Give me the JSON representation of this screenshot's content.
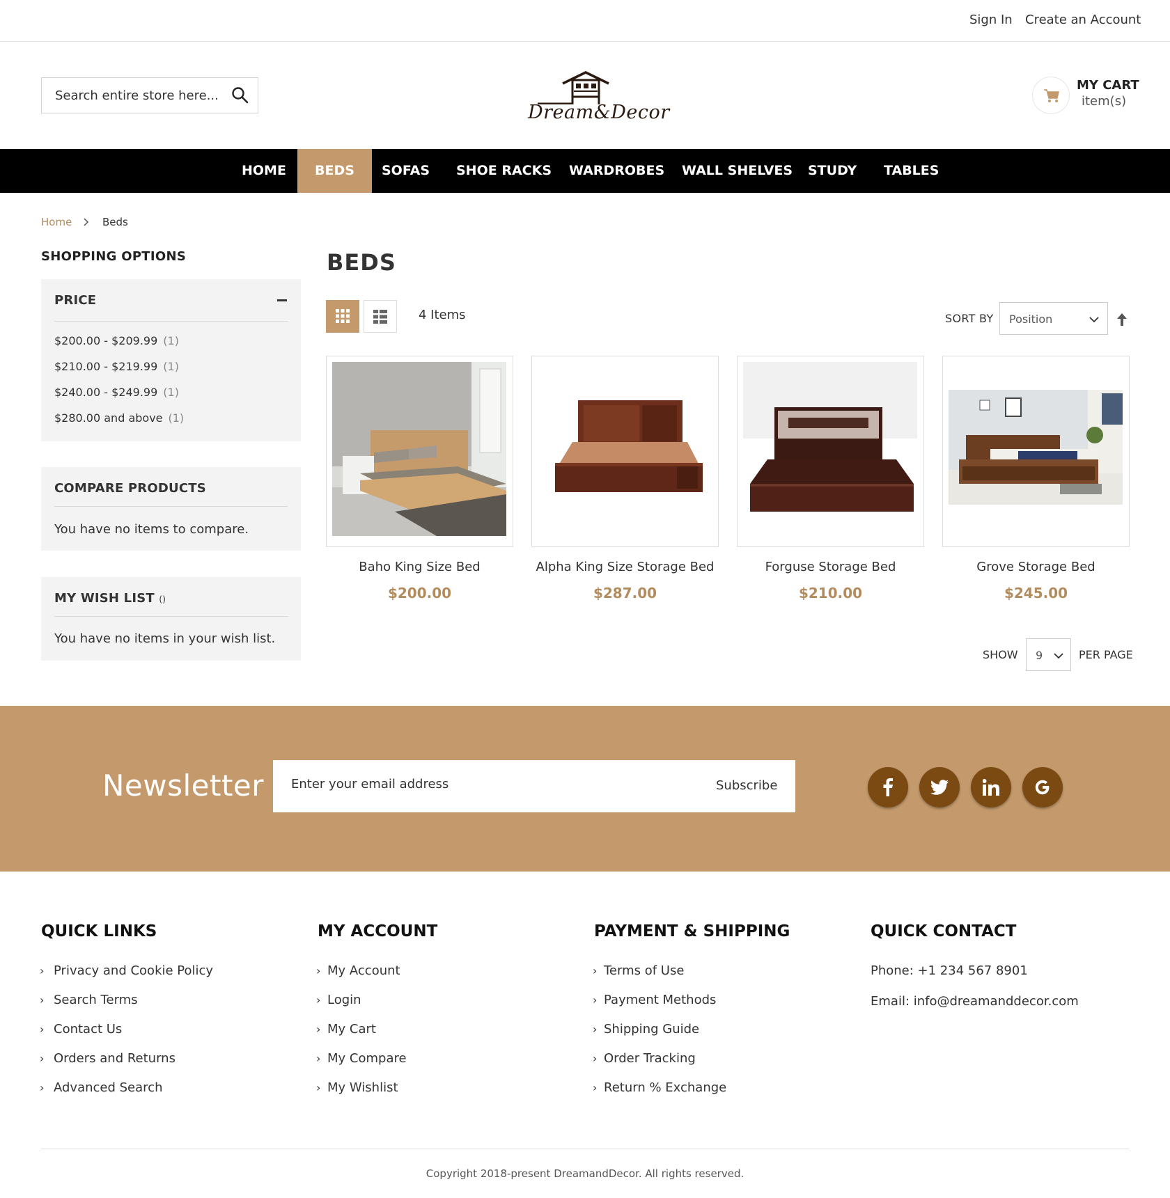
{
  "top_links": {
    "sign_in": "Sign In",
    "create_account": "Create an Account"
  },
  "search": {
    "placeholder": "Search entire store here..."
  },
  "logo": {
    "text": "Dream&Decor"
  },
  "cart": {
    "title": "MY CART",
    "items": "item(s)"
  },
  "nav": {
    "items": [
      "HOME",
      "BEDS",
      "SOFAS",
      "SHOE RACKS",
      "WARDROBES",
      "WALL SHELVES",
      "STUDY",
      "TABLES"
    ],
    "active": "BEDS"
  },
  "breadcrumb": {
    "home": "Home",
    "current": "Beds"
  },
  "sidebar": {
    "heading": "SHOPPING OPTIONS",
    "price": {
      "title": "PRICE",
      "items": [
        {
          "label": "$200.00 - $209.99",
          "count": "(1)"
        },
        {
          "label": "$210.00 - $219.99",
          "count": "(1)"
        },
        {
          "label": "$240.00 - $249.99",
          "count": "(1)"
        },
        {
          "label": "$280.00 and above",
          "count": "(1)"
        }
      ]
    },
    "compare": {
      "title": "COMPARE PRODUCTS",
      "text": "You have no items to compare."
    },
    "wishlist": {
      "title": "MY WISH LIST",
      "suffix": "()",
      "text": "You have no items in your wish list."
    }
  },
  "main": {
    "title": "BEDS",
    "items_count": "4 Items",
    "sort_label": "SORT BY",
    "sort_value": "Position",
    "show_label": "SHOW",
    "per_page_value": "9",
    "per_page_label": "PER PAGE"
  },
  "products": [
    {
      "name": "Baho King Size Bed",
      "price": "$200.00"
    },
    {
      "name": "Alpha King Size Storage Bed",
      "price": "$287.00"
    },
    {
      "name": "Forguse Storage Bed",
      "price": "$210.00"
    },
    {
      "name": "Grove Storage Bed",
      "price": "$245.00"
    }
  ],
  "newsletter": {
    "title": "Newsletter",
    "placeholder": "Enter your email address",
    "button": "Subscribe",
    "social": [
      "f",
      "t",
      "in",
      "G"
    ]
  },
  "footer": {
    "quick_links": {
      "title": "QUICK LINKS",
      "items": [
        "Privacy and Cookie Policy",
        "Search Terms",
        "Contact Us",
        "Orders and Returns",
        "Advanced Search"
      ]
    },
    "my_account": {
      "title": "MY ACCOUNT",
      "items": [
        "My Account",
        "Login",
        "My Cart",
        "My Compare",
        "My Wishlist"
      ]
    },
    "payment": {
      "title": "PAYMENT & SHIPPING",
      "items": [
        "Terms of Use",
        "Payment Methods",
        "Shipping Guide",
        "Order Tracking",
        "Return % Exchange"
      ]
    },
    "contact": {
      "title": "QUICK CONTACT",
      "phone": "Phone: +1 234 567 8901",
      "email": "Email: info@dreamanddecor.com"
    },
    "copyright": "Copyright 2018-present DreamandDecor. All rights reserved."
  },
  "colors": {
    "accent": "#c49a6c",
    "price": "#b38c5e",
    "social": "#7a4a12",
    "nav_bg": "#000000"
  }
}
